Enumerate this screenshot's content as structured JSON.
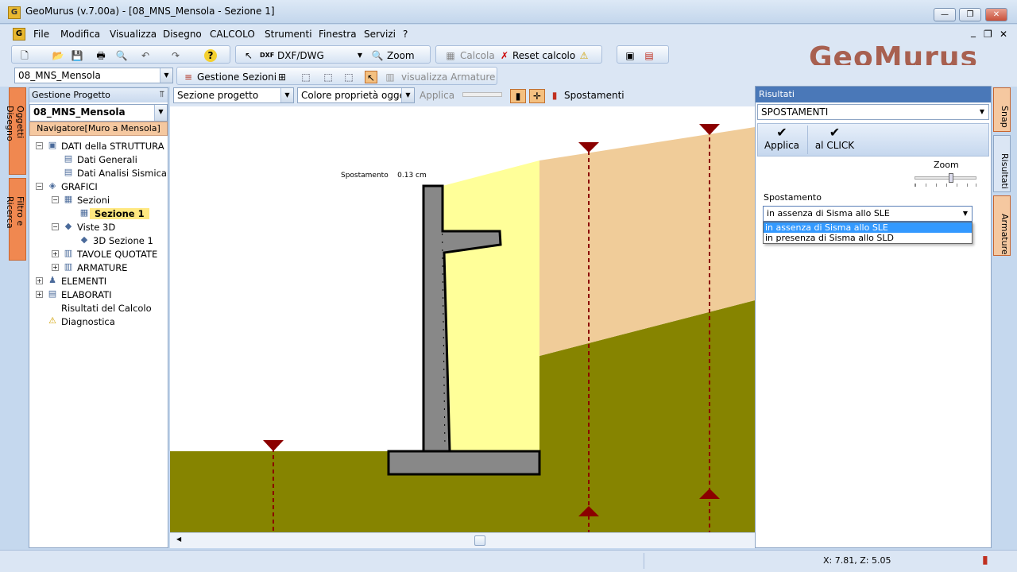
{
  "window": {
    "title": "GeoMurus (v.7.00a) - [08_MNS_Mensola - Sezione 1]",
    "app_icon_letter": "G",
    "minimize": "—",
    "restore": "❐",
    "close": "✕",
    "mdi_minimize": "_",
    "mdi_restore": "❐",
    "mdi_close": "✕"
  },
  "menu": {
    "items": [
      "File",
      "Modifica",
      "Visualizza",
      "Disegno",
      "CALCOLO",
      "Strumenti",
      "Finestra",
      "Servizi",
      "?"
    ]
  },
  "toolbar1": {
    "dxf_label": "DXF/DWG",
    "zoom_label": "Zoom",
    "calcola_label": "Calcola",
    "reset_label": "Reset calcolo"
  },
  "toolbar2": {
    "file_combo_value": "08_MNS_Mensola",
    "gestione_sezioni_label": "Gestione Sezioni",
    "visualizza_armature_label": "visualizza Armature"
  },
  "logo": {
    "text": "GeoMurus",
    "color": "#a86050"
  },
  "left_tabs": [
    "Oggetti Disegno",
    "Filtro e Ricerca"
  ],
  "project_panel": {
    "header": "Gestione Progetto",
    "pin": "⫪",
    "combo_value": "08_MNS_Mensola",
    "navigator": "Navigatore[Muro a Mensola]",
    "tree": [
      {
        "label": "DATI della STRUTTURA",
        "level": 0,
        "exp": "−"
      },
      {
        "label": "Dati Generali",
        "level": 1,
        "exp": ""
      },
      {
        "label": "Dati Analisi Sismica",
        "level": 1,
        "exp": ""
      },
      {
        "label": "GRAFICI",
        "level": 0,
        "exp": "−"
      },
      {
        "label": "Sezioni",
        "level": 1,
        "exp": "−"
      },
      {
        "label": "Sezione 1",
        "level": 2,
        "exp": "",
        "selected": true
      },
      {
        "label": "Viste 3D",
        "level": 1,
        "exp": "−"
      },
      {
        "label": "3D Sezione 1",
        "level": 2,
        "exp": ""
      },
      {
        "label": "TAVOLE QUOTATE",
        "level": 1,
        "exp": "+"
      },
      {
        "label": "ARMATURE",
        "level": 1,
        "exp": "+"
      },
      {
        "label": "ELEMENTI",
        "level": 0,
        "exp": "+"
      },
      {
        "label": "ELABORATI",
        "level": 0,
        "exp": "+"
      },
      {
        "label": "Risultati del Calcolo",
        "level": 0,
        "exp": ""
      },
      {
        "label": "Diagnostica",
        "level": 0,
        "exp": ""
      }
    ]
  },
  "drawing_toolbar": {
    "sezione_combo": "Sezione progetto",
    "colore_combo": "Colore proprietà oggetti",
    "applica_label": "Applica",
    "spostamenti_label": "Spostamenti"
  },
  "canvas": {
    "annotation": "Spostamento    0.13 cm",
    "colors": {
      "ground": "#868400",
      "backfill": "#ffff99",
      "upper_soil": "#f0cc99",
      "wall": "#888888",
      "marker": "#8b0000"
    }
  },
  "results_panel": {
    "header": "Risultati",
    "combo_value": "SPOSTAMENTI",
    "applica_label": "Applica",
    "click_label": "al CLICK",
    "zoom_label": "Zoom",
    "zoom_level": 0.6,
    "spostamento_label": "Spostamento",
    "spostamento_value": "in assenza di Sisma allo SLE",
    "options": [
      "in assenza di Sisma allo SLE",
      "in presenza di Sisma allo SLD"
    ]
  },
  "right_tabs": [
    "Snap",
    "Risultati",
    "Armature"
  ],
  "status": {
    "coords": "X: 7.81, Z: 5.05"
  }
}
